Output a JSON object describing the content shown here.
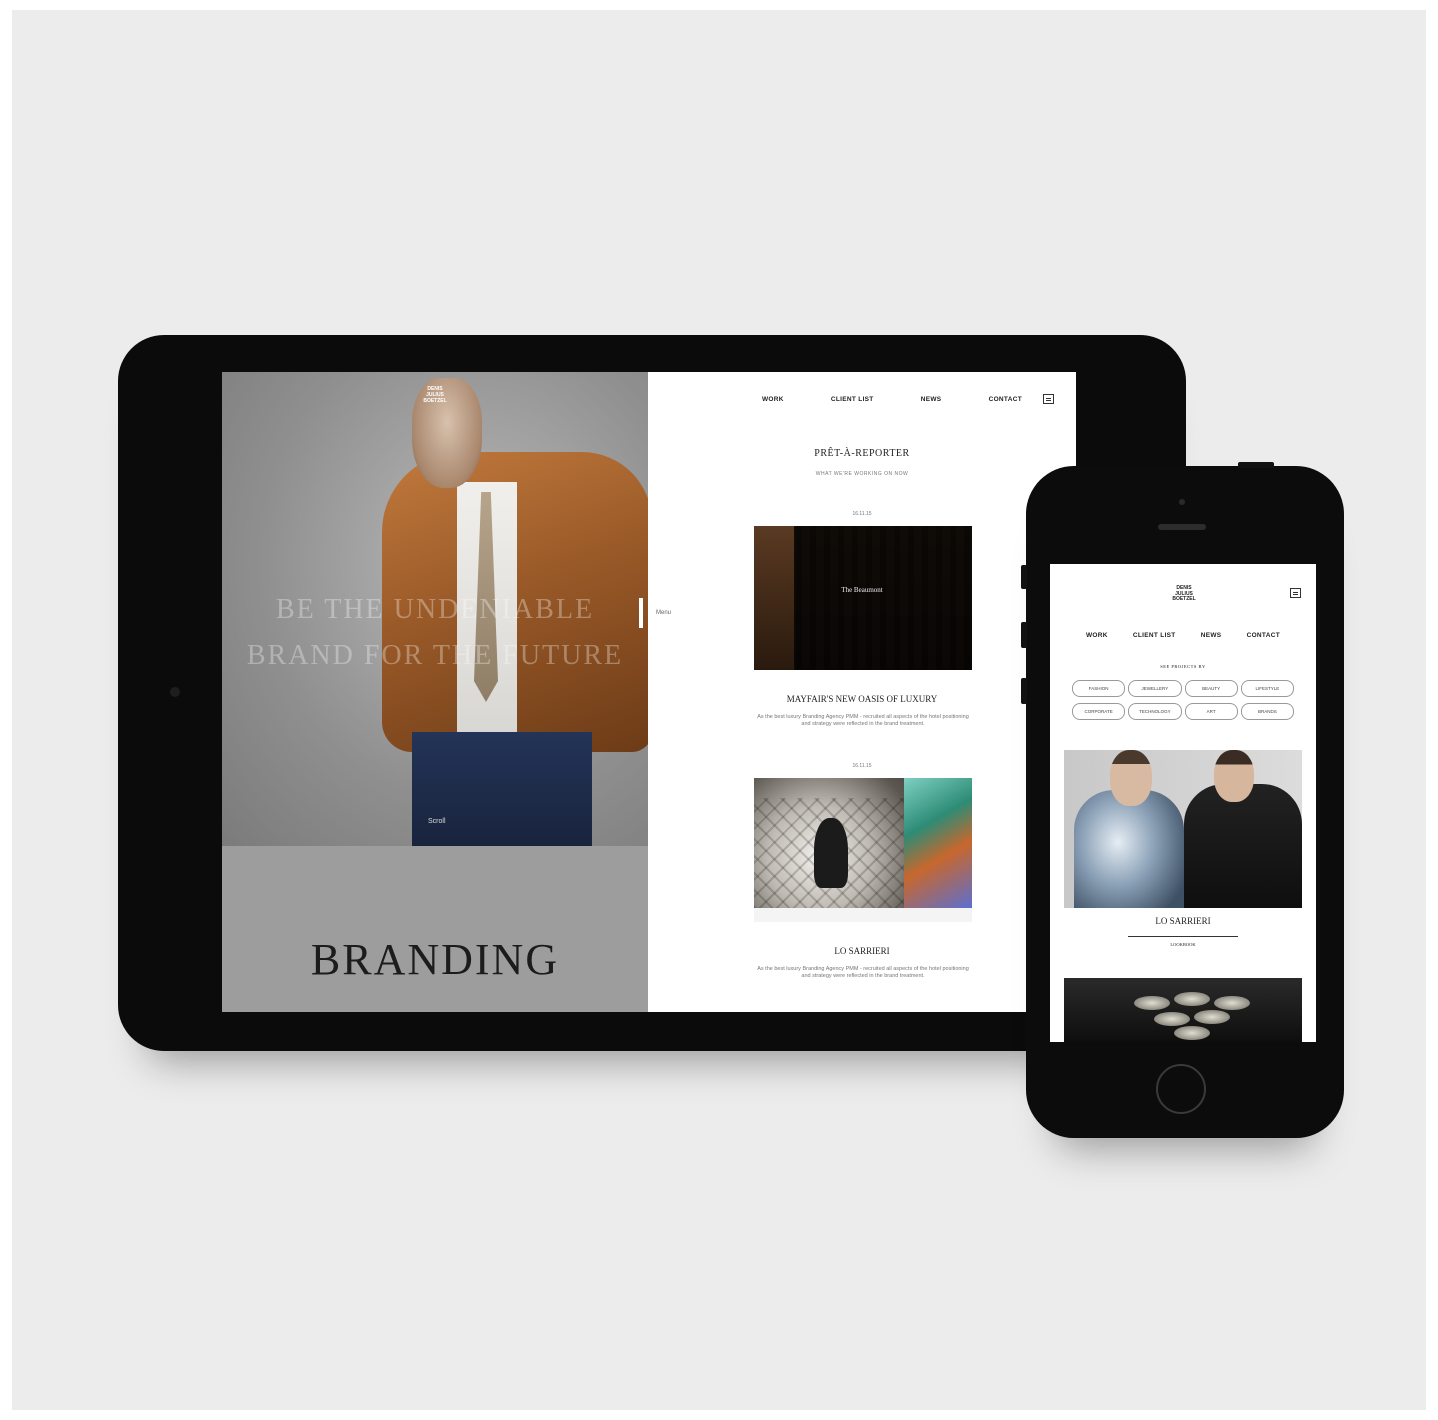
{
  "tablet": {
    "hero": {
      "headline_line1": "BE THE UNDENIABLE",
      "headline_line2": "BRAND FOR THE FUTURE",
      "caption": "Scroll",
      "logo_lines": [
        "DENIS",
        "JULIUS",
        "BOETZEL"
      ]
    },
    "side_label": "Menu",
    "section_label": "BRANDING",
    "nav": [
      "WORK",
      "CLIENT LIST",
      "NEWS",
      "CONTACT"
    ],
    "menu_icon": "hamburger-icon",
    "section": {
      "title": "PRÊT-À-REPORTER",
      "subtitle": "WHAT WE'RE WORKING ON NOW"
    },
    "articles": [
      {
        "date": "16.11.15",
        "image_sign": "The Beaumont",
        "title": "MAYFAIR'S NEW OASIS OF LUXURY",
        "body": "As the best luxury Branding Agency PMM - recruited all aspects of the hotel positioning and strategy were reflected in the brand treatment."
      },
      {
        "date": "16.11.15",
        "title": "LO SARRIERI",
        "body": "As the best luxury Branding Agency PMM - recruited all aspects of the hotel positioning and strategy were reflected in the brand treatment."
      }
    ]
  },
  "phone": {
    "logo_lines": [
      "DENIS",
      "JULIUS",
      "BOETZEL"
    ],
    "menu_icon": "hamburger-icon",
    "nav": [
      "WORK",
      "CLIENT LIST",
      "NEWS",
      "CONTACT"
    ],
    "filter_label": "SEE PROJECTS BY",
    "filters": [
      "FASHION",
      "JEWELLERY",
      "BEAUTY",
      "LIFESTYLE",
      "CORPORATE",
      "TECHNOLOGY",
      "ART",
      "BRANDS"
    ],
    "project": {
      "title": "LO SARRIERI",
      "subtitle": "LOOKBOOK"
    }
  }
}
